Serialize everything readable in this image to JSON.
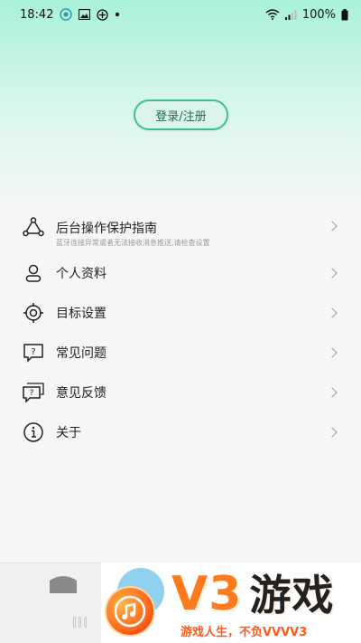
{
  "status_bar": {
    "time": "18:42",
    "battery": "100%"
  },
  "header": {
    "login_label": "登录/注册"
  },
  "menu": {
    "items": [
      {
        "label": "后台操作保护指南",
        "sub": "蓝牙连接异常或者无法接收消息推送,请检查设置",
        "icon": "triangle-nodes-icon"
      },
      {
        "label": "个人资料",
        "icon": "person-icon"
      },
      {
        "label": "目标设置",
        "icon": "target-icon"
      },
      {
        "label": "常见问题",
        "icon": "question-bubble-icon"
      },
      {
        "label": "意见反馈",
        "icon": "feedback-bubble-icon"
      },
      {
        "label": "关于",
        "icon": "info-icon"
      }
    ]
  },
  "watermark": {
    "brand_a": "V3",
    "brand_b": "游戏",
    "slogan": "游戏人生，不负VVVV3"
  },
  "colors": {
    "accent": "#3bbf9a",
    "header_top": "#a9f1d8",
    "watermark_orange": "#ff7a1a"
  }
}
